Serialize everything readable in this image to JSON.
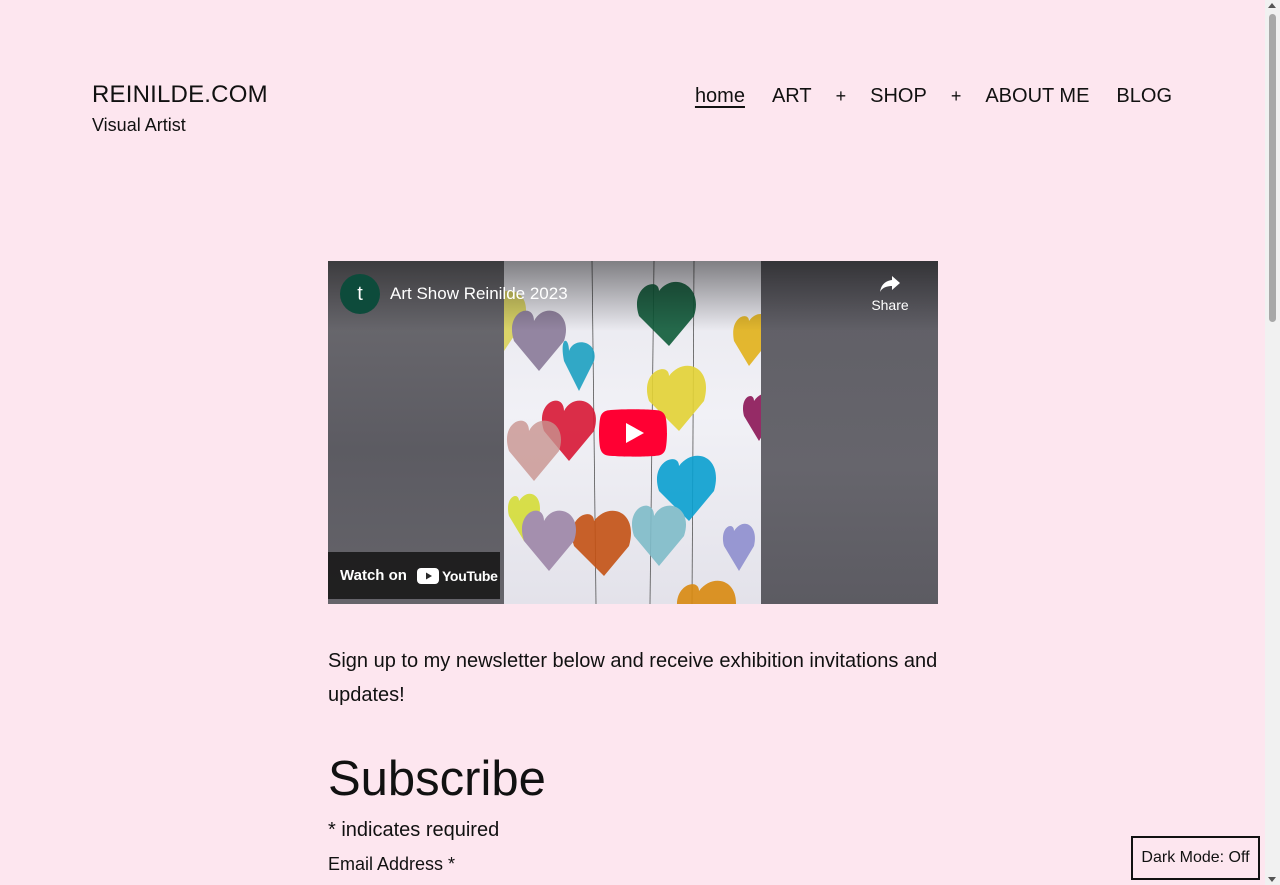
{
  "site": {
    "title": "REINILDE.COM",
    "tagline": "Visual Artist"
  },
  "nav": {
    "items": [
      {
        "label": "home",
        "current": true
      },
      {
        "label": "ART",
        "has_submenu": true
      },
      {
        "label": "SHOP",
        "has_submenu": true
      },
      {
        "label": "ABOUT ME"
      },
      {
        "label": "BLOG"
      }
    ],
    "submenu_toggle": "+"
  },
  "video": {
    "channel_initial": "t",
    "title": "Art Show Reinilde 2023",
    "share_label": "Share",
    "watch_on_label": "Watch on",
    "youtube_word": "YouTube",
    "colors": {
      "play_red": "#ff0000",
      "avatar": "#0d4b3b"
    }
  },
  "content": {
    "intro": "Sign up to my newsletter below and receive exhibition invitations and updates!",
    "subscribe_heading": "Subscribe",
    "required_note": "* indicates required",
    "email_label": "Email Address *"
  },
  "dark_mode": {
    "label": "Dark Mode: Off"
  },
  "theme": {
    "background": "#fde6ef",
    "text": "#111111"
  }
}
